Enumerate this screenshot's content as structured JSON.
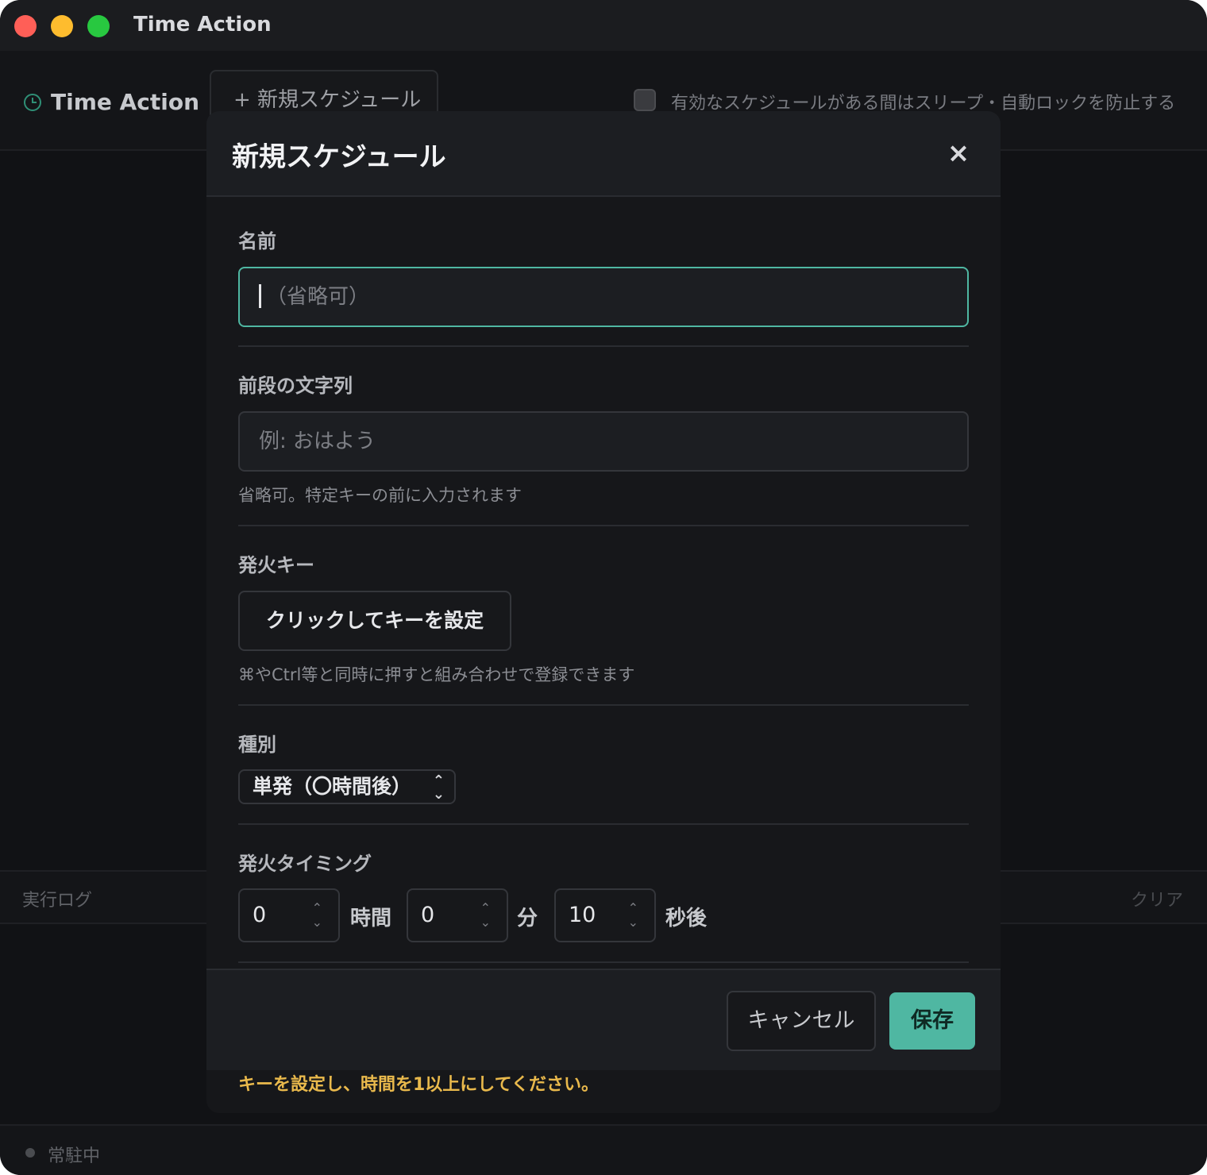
{
  "window": {
    "title": "Time Action"
  },
  "header": {
    "brand": "Time Action",
    "new_button": "+ 新規スケジュール",
    "prevent_sleep_label": "有効なスケジュールがある間はスリープ・自動ロックを防止する"
  },
  "log": {
    "title": "実行ログ",
    "clear": "クリア"
  },
  "status": {
    "text": "常駐中"
  },
  "modal": {
    "title": "新規スケジュール",
    "close": "×",
    "name": {
      "label": "名前",
      "placeholder": "（省略可）"
    },
    "prefix": {
      "label": "前段の文字列",
      "placeholder": "例: おはよう",
      "hint": "省略可。特定キーの前に入力されます"
    },
    "trigger_key": {
      "label": "発火キー",
      "button": "クリックしてキーを設定",
      "hint": "⌘やCtrl等と同時に押すと組み合わせで登録できます"
    },
    "type": {
      "label": "種別",
      "selected": "単発（〇時間後）"
    },
    "timing": {
      "label": "発火タイミング",
      "hours": "0",
      "hours_unit": "時間",
      "minutes": "0",
      "minutes_unit": "分",
      "seconds": "10",
      "seconds_unit": "秒後"
    },
    "footer": {
      "cancel": "キャンセル",
      "save": "保存"
    },
    "error": "キーを設定し、時間を1以上にしてください。"
  },
  "colors": {
    "accent": "#4fb7a2",
    "warning": "#e9b94c"
  },
  "icons": {
    "close": "close-icon",
    "brand": "clock-icon",
    "select": "chevron-up-down-icon",
    "spin": "stepper-arrows-icon"
  }
}
